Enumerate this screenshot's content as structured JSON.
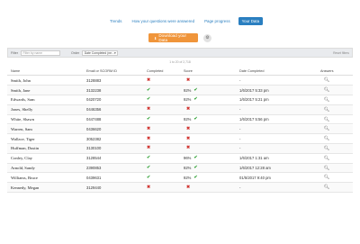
{
  "nav": {
    "tabs": [
      {
        "label": "Trends"
      },
      {
        "label": "How your questions were answered"
      },
      {
        "label": "Page progress"
      },
      {
        "label": "Your Data"
      }
    ]
  },
  "actions": {
    "download_label": "Download your Data",
    "download_icon": "download-icon",
    "settings_icon": "gear-icon"
  },
  "filters": {
    "filter_label": "Filter",
    "filter_placeholder": "Filter by name",
    "order_label": "Order",
    "order_value": "Date Completed (ne...",
    "reset_label": "Reset filters"
  },
  "table": {
    "count_text": "1 to 20 of 2,718",
    "headers": {
      "name": "Name",
      "email": "Email or SCORM ID",
      "completed": "Completed",
      "score": "Score",
      "date": "Date Completed",
      "answers": "Answers"
    },
    "rows": [
      {
        "name": "Smith, John",
        "email": "3128883",
        "completed": "✖",
        "score": "",
        "score_mark": "✖",
        "date": "-"
      },
      {
        "name": "Smith, Jane",
        "email": "3132238",
        "completed": "✔",
        "score": "92%",
        "score_mark": "✔",
        "date": "1/6/2017 5:33 pm"
      },
      {
        "name": "Edwards, Sam",
        "email": "0420720",
        "completed": "✔",
        "score": "92%",
        "score_mark": "✔",
        "date": "1/6/2017 5:21 pm"
      },
      {
        "name": "Jones, Shelly",
        "email": "0446356",
        "completed": "✖",
        "score": "",
        "score_mark": "✖",
        "date": "-"
      },
      {
        "name": "White, Shawn",
        "email": "0447488",
        "completed": "✔",
        "score": "92%",
        "score_mark": "✔",
        "date": "1/6/2017 5:56 pm"
      },
      {
        "name": "Warren, Sam",
        "email": "0436620",
        "completed": "✖",
        "score": "",
        "score_mark": "✖",
        "date": "-"
      },
      {
        "name": "Wallace, Tiger",
        "email": "3052382",
        "completed": "✖",
        "score": "",
        "score_mark": "✖",
        "date": "-"
      },
      {
        "name": "Huffman, Dustin",
        "email": "3130100",
        "completed": "✖",
        "score": "",
        "score_mark": "✖",
        "date": "-"
      },
      {
        "name": "Conley, Clay",
        "email": "3128544",
        "completed": "✔",
        "score": "96%",
        "score_mark": "✔",
        "date": "1/6/2017 1:31 am"
      },
      {
        "name": "Arnold, Sandy",
        "email": "2390853",
        "completed": "✔",
        "score": "92%",
        "score_mark": "✔",
        "date": "1/6/2017 12:28 am"
      },
      {
        "name": "Williams, Bruce",
        "email": "0439631",
        "completed": "✔",
        "score": "92%",
        "score_mark": "✔",
        "date": "01/5/2017 9:40 pm"
      },
      {
        "name": "Kennedy, Megan",
        "email": "3129440",
        "completed": "✖",
        "score": "",
        "score_mark": "✖",
        "date": "-"
      }
    ]
  },
  "colors": {
    "accent": "#2a7fc0",
    "download": "#f0953a",
    "check": "#35a33a",
    "cross": "#d0322e"
  }
}
